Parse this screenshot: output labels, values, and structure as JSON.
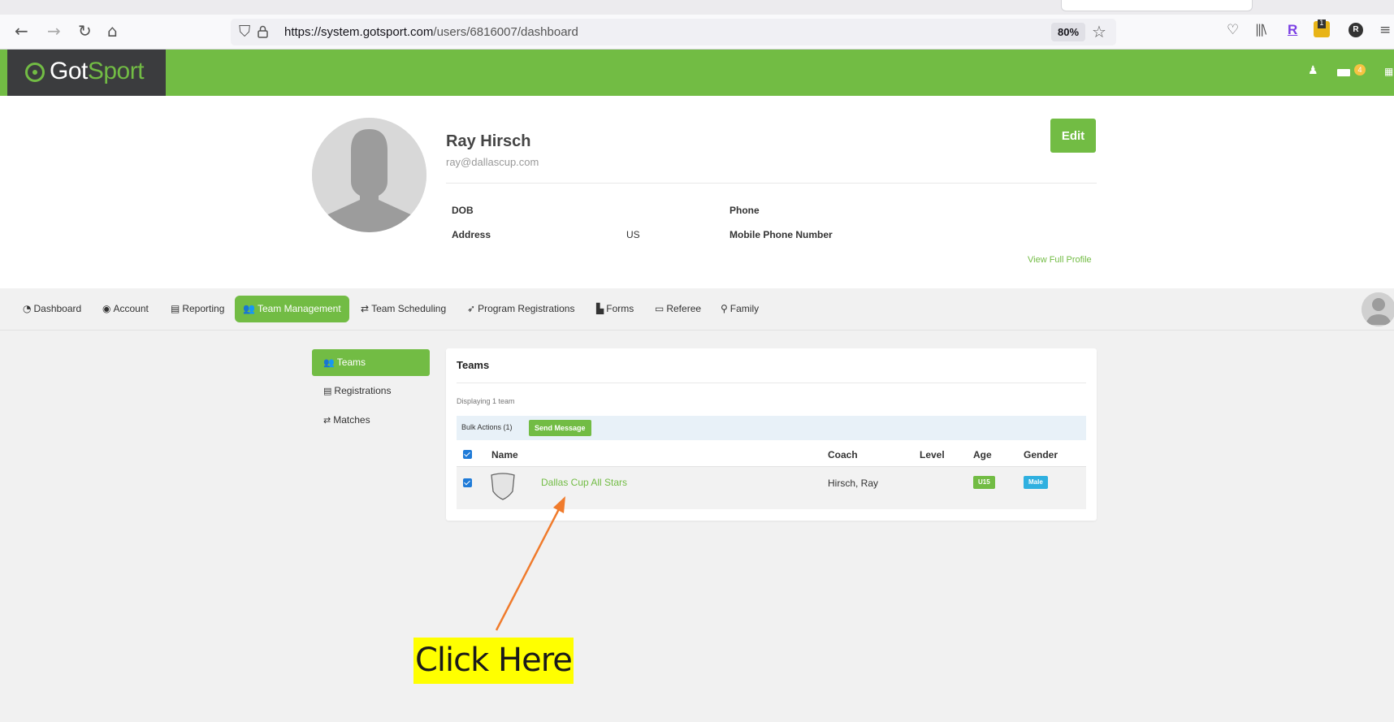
{
  "browser": {
    "url_host": "https://system.gotsport.com",
    "url_path": "/users/6816007/dashboard",
    "zoom": "80%",
    "toolbar_badge": "1",
    "profile_initial": "R"
  },
  "header": {
    "logo_got": "Got",
    "logo_sport": "Sport",
    "mail_badge": "4"
  },
  "profile": {
    "name": "Ray Hirsch",
    "email": "ray@dallascup.com",
    "dob_label": "DOB",
    "address_label": "Address",
    "address_value": "US",
    "phone_label": "Phone",
    "mobile_label": "Mobile Phone Number",
    "edit_label": "Edit",
    "view_full_label": "View Full Profile"
  },
  "main_tabs": [
    {
      "label": "Dashboard",
      "icon": "dashboard-icon"
    },
    {
      "label": "Account",
      "icon": "user-circle-icon"
    },
    {
      "label": "Reporting",
      "icon": "file-icon"
    },
    {
      "label": "Team Management",
      "icon": "users-icon",
      "active": true
    },
    {
      "label": "Team Scheduling",
      "icon": "exchange-icon"
    },
    {
      "label": "Program Registrations",
      "icon": "send-icon"
    },
    {
      "label": "Forms",
      "icon": "document-icon"
    },
    {
      "label": "Referee",
      "icon": "calendar-icon"
    },
    {
      "label": "Family",
      "icon": "sitemap-icon"
    }
  ],
  "sidebar": [
    {
      "label": "Teams",
      "icon": "users-icon",
      "active": true
    },
    {
      "label": "Registrations",
      "icon": "list-icon"
    },
    {
      "label": "Matches",
      "icon": "exchange-icon"
    }
  ],
  "teams": {
    "title": "Teams",
    "displaying": "Displaying 1 team",
    "bulk_actions": "Bulk Actions (1)",
    "send_message": "Send Message",
    "columns": [
      "Name",
      "Coach",
      "Level",
      "Age",
      "Gender"
    ],
    "rows": [
      {
        "name": "Dallas Cup All Stars",
        "coach": "Hirsch, Ray",
        "level": "",
        "age": "U15",
        "gender": "Male"
      }
    ]
  },
  "colors": {
    "brand_green": "#72bc44",
    "gender_blue": "#2fb0e0",
    "annotation_arrow": "#f07b2c",
    "annotation_highlight": "#ffff00"
  },
  "annotation": {
    "text": "Click Here"
  }
}
